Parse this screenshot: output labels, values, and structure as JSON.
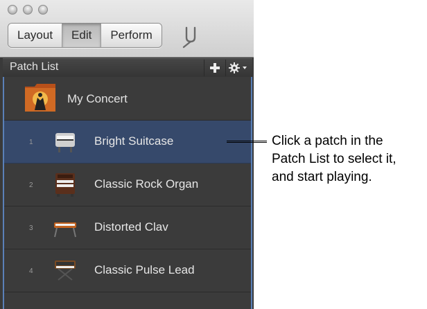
{
  "window": {
    "controls": [
      "close-button",
      "minimize-button",
      "zoom-button"
    ]
  },
  "toolbar": {
    "modes": [
      {
        "label": "Layout",
        "active": false
      },
      {
        "label": "Edit",
        "active": true
      },
      {
        "label": "Perform",
        "active": false
      }
    ],
    "tuner_icon": "tuning-fork-icon"
  },
  "patch_list": {
    "title": "Patch List",
    "add_icon": "plus-icon",
    "action_icon": "gear-icon",
    "concert": {
      "label": "My Concert",
      "icon": "concert-folder-icon"
    },
    "patches": [
      {
        "number": "1",
        "label": "Bright Suitcase",
        "icon": "electric-piano-icon",
        "selected": true
      },
      {
        "number": "2",
        "label": "Classic Rock Organ",
        "icon": "organ-icon",
        "selected": false
      },
      {
        "number": "3",
        "label": "Distorted Clav",
        "icon": "clavinet-icon",
        "selected": false
      },
      {
        "number": "4",
        "label": "Classic Pulse Lead",
        "icon": "synthesizer-icon",
        "selected": false
      }
    ]
  },
  "callout": {
    "lines": [
      "Click a patch in the",
      "Patch List to select it,",
      "and start playing."
    ]
  },
  "colors": {
    "selection": "#36496b",
    "focus_ring": "#5a80b8",
    "list_background": "#3b3b3b"
  }
}
